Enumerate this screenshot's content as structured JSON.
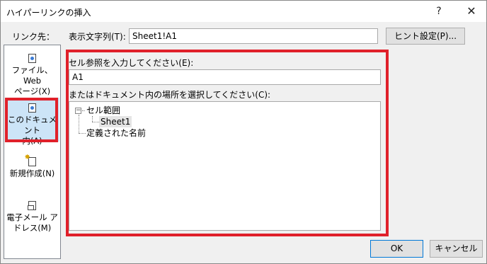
{
  "window": {
    "title": "ハイパーリンクの挿入",
    "help_label": "?",
    "close_label": "✕"
  },
  "link_to": {
    "label": "リンク先："
  },
  "display_text": {
    "label": "表示文字列(T):",
    "value": "Sheet1!A1"
  },
  "hint_button": {
    "label": "ヒント設定(P)..."
  },
  "sidebar": {
    "items": [
      {
        "line1": "ファイル、Web",
        "line2": "ページ(X)",
        "icon": "file-globe-icon"
      },
      {
        "line1": "このドキュメント",
        "line2": "内(A)",
        "icon": "document-place-icon",
        "selected": true
      },
      {
        "line1": "新規作成(N)",
        "line2": "",
        "icon": "new-document-icon"
      },
      {
        "line1": "電子メール ア",
        "line2": "ドレス(M)",
        "icon": "email-address-icon"
      }
    ]
  },
  "cell_reference": {
    "label": "セル参照を入力してください(E):",
    "value": "A1"
  },
  "place": {
    "label": "またはドキュメント内の場所を選択してください(C):",
    "tree": {
      "root": "セル範囲",
      "root_toggle": "−",
      "child": "Sheet1",
      "second_root": "定義された名前"
    }
  },
  "buttons": {
    "ok": "OK",
    "cancel": "キャンセル"
  },
  "colors": {
    "highlight": "#e0202a",
    "selected_bg": "#cce4f7",
    "default_button_border": "#0078d7"
  }
}
